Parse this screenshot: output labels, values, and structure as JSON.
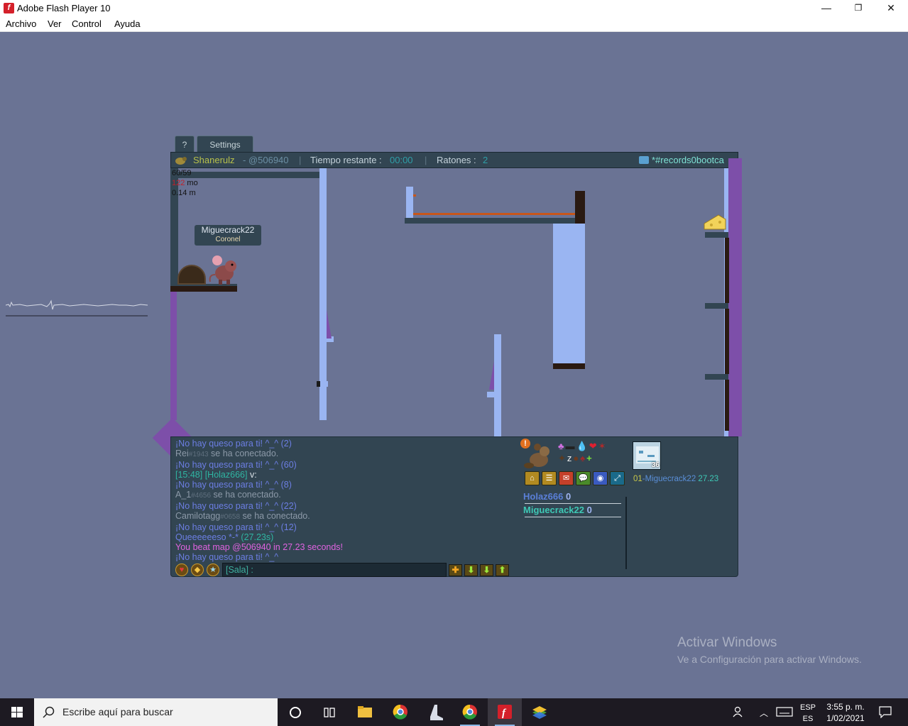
{
  "window": {
    "title": "Adobe Flash Player 10",
    "app_icon_glyph": "f",
    "minimize": "—",
    "maximize": "❐",
    "close": "✕"
  },
  "menu": [
    "Archivo",
    "Ver",
    "Control",
    "Ayuda"
  ],
  "game": {
    "tabs": {
      "help": "?",
      "settings": "Settings"
    },
    "topbar": {
      "shaman": "Shanerulz",
      "map_code": "- @506940",
      "sep": "|",
      "time_label": "Tiempo restante :",
      "time_value": "00:00",
      "mice_label": "Ratones :",
      "mice_value": "2",
      "room": "*#records0bootca"
    },
    "stats": {
      "fps": "60/59",
      "ms_value": "122",
      "ms_unit": "mo",
      "distance": "0.14 m"
    },
    "player": {
      "name": "Miguecrack22",
      "title": "Coronel"
    },
    "chat": [
      {
        "text": "¡No hay queso para ti! ^_^ (2)",
        "cls": "c-no"
      },
      {
        "name": "Rei",
        "tag": "#1943",
        "rest": " se ha conectado.",
        "cls": "c-gray"
      },
      {
        "text": "¡No hay queso para ti! ^_^ (60)",
        "cls": "c-no"
      },
      {
        "prefix": "[15:48] [Holaz666]",
        "rest": " v:",
        "cls": "c-teal"
      },
      {
        "text": "¡No hay queso para ti! ^_^ (8)",
        "cls": "c-no"
      },
      {
        "name": "A_1",
        "tag": "#4656",
        "rest": " se ha conectado.",
        "cls": "c-gray"
      },
      {
        "text": "¡No hay queso para ti! ^_^ (22)",
        "cls": "c-no"
      },
      {
        "name": "Camilotagg",
        "tag": "#0658",
        "rest": " se ha conectado.",
        "cls": "c-gray"
      },
      {
        "text": "¡No hay queso para ti! ^_^ (12)",
        "cls": "c-no"
      },
      {
        "prefix": "Queeeeeeso *-*",
        "rest": " (27.23s)",
        "cls": "c-no"
      },
      {
        "text": "You beat map @506940 in 27.23 seconds!",
        "cls": "c-pink"
      },
      {
        "text": "¡No hay queso para ti! ^_^",
        "cls": "c-no"
      }
    ],
    "chat_input": {
      "value": "[Sala] :"
    },
    "chat_buttons": [
      "✚",
      "⬇",
      "⬇",
      "⬆"
    ],
    "scores": [
      {
        "name": "Holaz666",
        "score": "0"
      },
      {
        "name": "Miguecrack22",
        "score": "0"
      }
    ],
    "record": {
      "rank": "01",
      "name": "-Miguecrack22",
      "time": "27.23"
    },
    "map_thumb_number": "36",
    "menu_icons": [
      "⌂",
      "☰",
      "✉",
      "💬",
      "◉",
      "⤢"
    ]
  },
  "watermark": {
    "line1": "Activar Windows",
    "line2": "Ve a Configuración para activar Windows."
  },
  "taskbar": {
    "search_placeholder": "Escribe aquí para buscar",
    "lang_top": "ESP",
    "lang_bottom": "ES",
    "time": "3:55 p. m.",
    "date": "1/02/2021"
  }
}
